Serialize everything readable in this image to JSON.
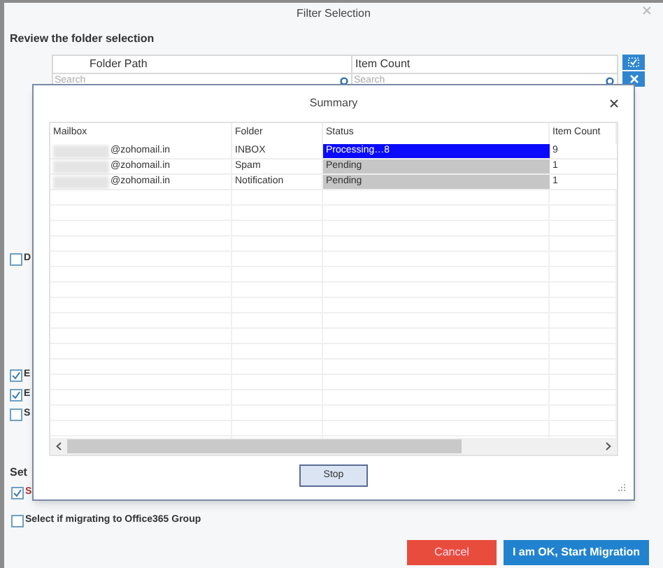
{
  "window": {
    "title": "Filter Selection"
  },
  "heading": "Review the folder selection",
  "folder_table": {
    "columns": [
      {
        "label": "Folder Path",
        "placeholder": "Search"
      },
      {
        "label": "Item Count",
        "placeholder": "Search"
      }
    ]
  },
  "left_checkboxes": [
    {
      "label": "D",
      "checked": false
    },
    {
      "label": "E",
      "checked": true
    },
    {
      "label": "E",
      "checked": true
    },
    {
      "label": "S",
      "checked": false
    }
  ],
  "section_label": "Set",
  "bottom_checkboxes": [
    {
      "label": "S",
      "checked": true
    },
    {
      "label": "Select if migrating to Office365 Group",
      "checked": false
    }
  ],
  "buttons": [
    {
      "label": "Cancel",
      "kind": "cancel"
    },
    {
      "label": "I am OK, Start Migration",
      "kind": "primary"
    }
  ],
  "summary": {
    "title": "Summary",
    "columns": [
      "Mailbox",
      "Folder",
      "Status",
      "Item Count"
    ],
    "rows": [
      {
        "mailbox": "@zohomail.in",
        "folder": "INBOX",
        "status": "Processing…8",
        "kind": "processing",
        "item_count": "9"
      },
      {
        "mailbox": "@zohomail.in",
        "folder": "Spam",
        "status": "Pending",
        "kind": "pending",
        "item_count": "1"
      },
      {
        "mailbox": "@zohomail.in",
        "folder": "Notification",
        "status": "Pending",
        "kind": "pending",
        "item_count": "1"
      }
    ],
    "stop_button": "Stop"
  }
}
